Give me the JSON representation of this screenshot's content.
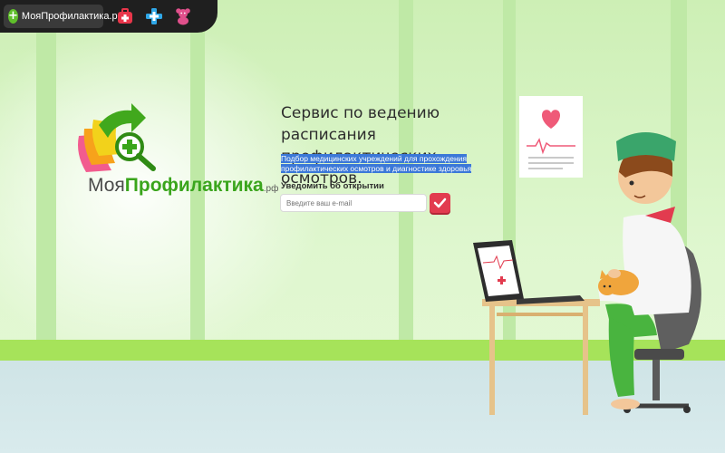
{
  "topbar": {
    "brand_label": "МояПрофилактика.рф",
    "icons": [
      "medical-kit-icon",
      "medical-cross-icon",
      "teddy-bear-icon"
    ]
  },
  "logo": {
    "name_part1": "Моя",
    "name_part2": "Профилактика",
    "suffix": ".рф"
  },
  "hero": {
    "title": "Сервис по ведению расписания профилактических осмотров.",
    "description_line1": "Подбор медицинских учреждений для прохождения",
    "description_line2": "профилактических осмотров и диагностике здоровья"
  },
  "notify": {
    "label": "Уведомить об открытии",
    "email_placeholder": "Введите ваш e-mail",
    "email_value": ""
  },
  "colors": {
    "accent": "#3aa51c",
    "button": "#e23b4f",
    "selection": "#3b78d8"
  }
}
